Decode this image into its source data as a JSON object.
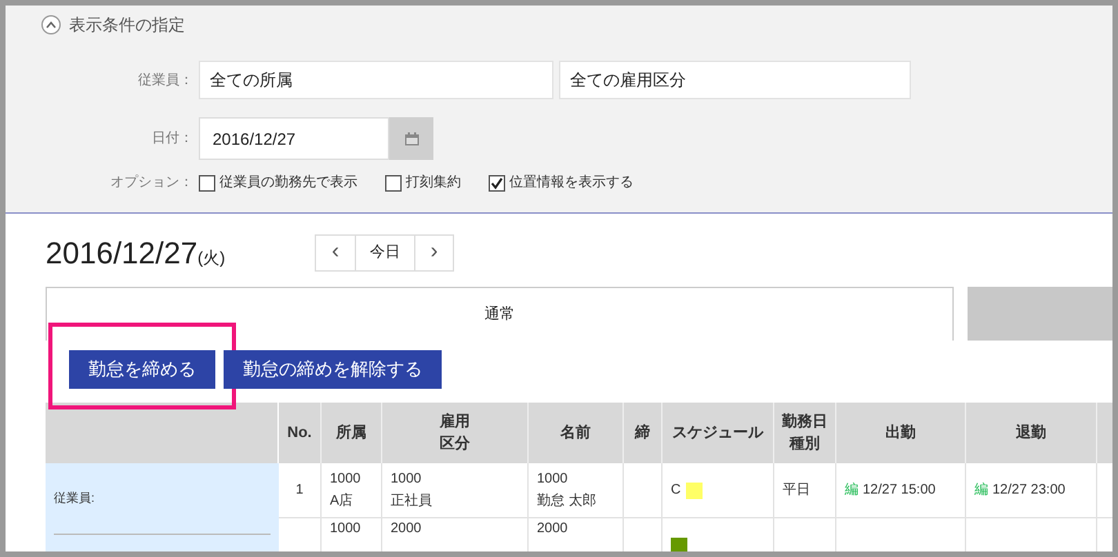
{
  "filter_panel": {
    "title": "表示条件の指定",
    "expanded": true,
    "employee": {
      "label": "従業員：",
      "department": "全ての所属",
      "employment_type": "全ての雇用区分"
    },
    "date": {
      "label": "日付：",
      "value": "2016/12/27"
    },
    "options": {
      "label": "オプション：",
      "items": [
        {
          "label": "従業員の勤務先で表示",
          "checked": false
        },
        {
          "label": "打刻集約",
          "checked": false
        },
        {
          "label": "位置情報を表示する",
          "checked": true
        }
      ]
    }
  },
  "day_heading": {
    "date": "2016/12/27",
    "weekday": "(火)"
  },
  "nav": {
    "prev": "‹",
    "today": "今日",
    "next": "›"
  },
  "tabs": [
    {
      "label": "通常",
      "selected": true
    },
    {
      "selected": false
    }
  ],
  "actions": [
    {
      "label": "勤怠を締める",
      "highlighted": true
    },
    {
      "label": "勤怠の締めを解除する",
      "highlighted": false
    }
  ],
  "table": {
    "filter_label": "従業員:",
    "columns": [
      "No.",
      "所属",
      "雇用区分",
      "名前",
      "締",
      "スケジュール",
      "勤務日種別",
      "出勤",
      "退勤"
    ],
    "rows": [
      {
        "no": "1",
        "dept": [
          "1000",
          "A店"
        ],
        "type": [
          "1000",
          "正社員"
        ],
        "name": [
          "1000",
          "勤怠 太郎"
        ],
        "schedule": {
          "code": "C",
          "color": "#ffff66"
        },
        "day_type": "平日",
        "in_mark": "編",
        "in": "12/27 15:00",
        "out_mark": "編",
        "out": "12/27 23:00"
      },
      {
        "dept": [
          "1000"
        ],
        "type": [
          "2000"
        ],
        "name": [
          "2000"
        ],
        "schedule": {
          "color": "#669900"
        }
      }
    ]
  }
}
